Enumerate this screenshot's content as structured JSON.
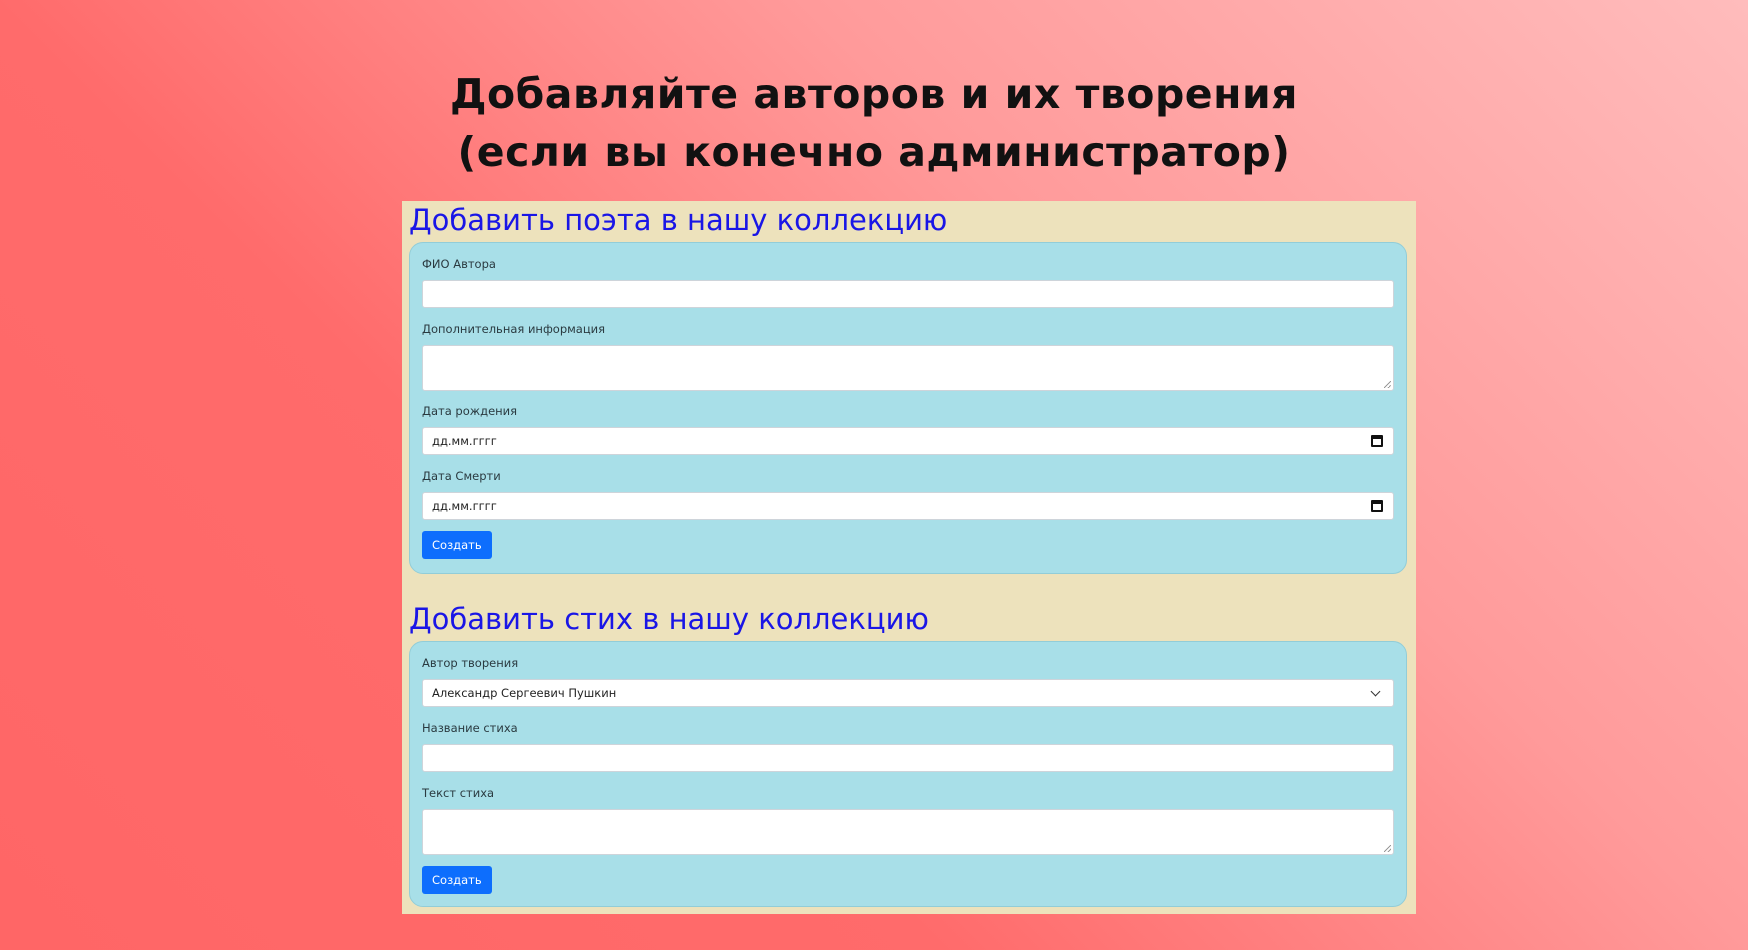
{
  "page": {
    "heading_line1": "Добавляйте авторов и их творения",
    "heading_line2": "(если вы конечно администратор)"
  },
  "poet_form": {
    "title": "Добавить поэта в нашу коллекцию",
    "name_label": "ФИО Автора",
    "name_value": "",
    "info_label": "Дополнительная информация",
    "info_value": "",
    "birth_label": "Дата рождения",
    "birth_placeholder": "дд.мм.гггг",
    "death_label": "Дата Смерти",
    "death_placeholder": "дд.мм.гггг",
    "submit_label": "Создать"
  },
  "poem_form": {
    "title": "Добавить стих в нашу коллекцию",
    "author_label": "Автор творения",
    "author_selected": "Александр Сергеевич Пушкин",
    "poem_title_label": "Название стиха",
    "poem_title_value": "",
    "poem_text_label": "Текст стиха",
    "poem_text_value": "",
    "submit_label": "Создать"
  },
  "colors": {
    "accent": "#0d6efd",
    "title": "#1a16e6",
    "card": "#a8dfe8",
    "panel": "#ede2bc"
  },
  "icons": {
    "date_picker": "calendar-icon",
    "select": "chevron-down-icon"
  }
}
